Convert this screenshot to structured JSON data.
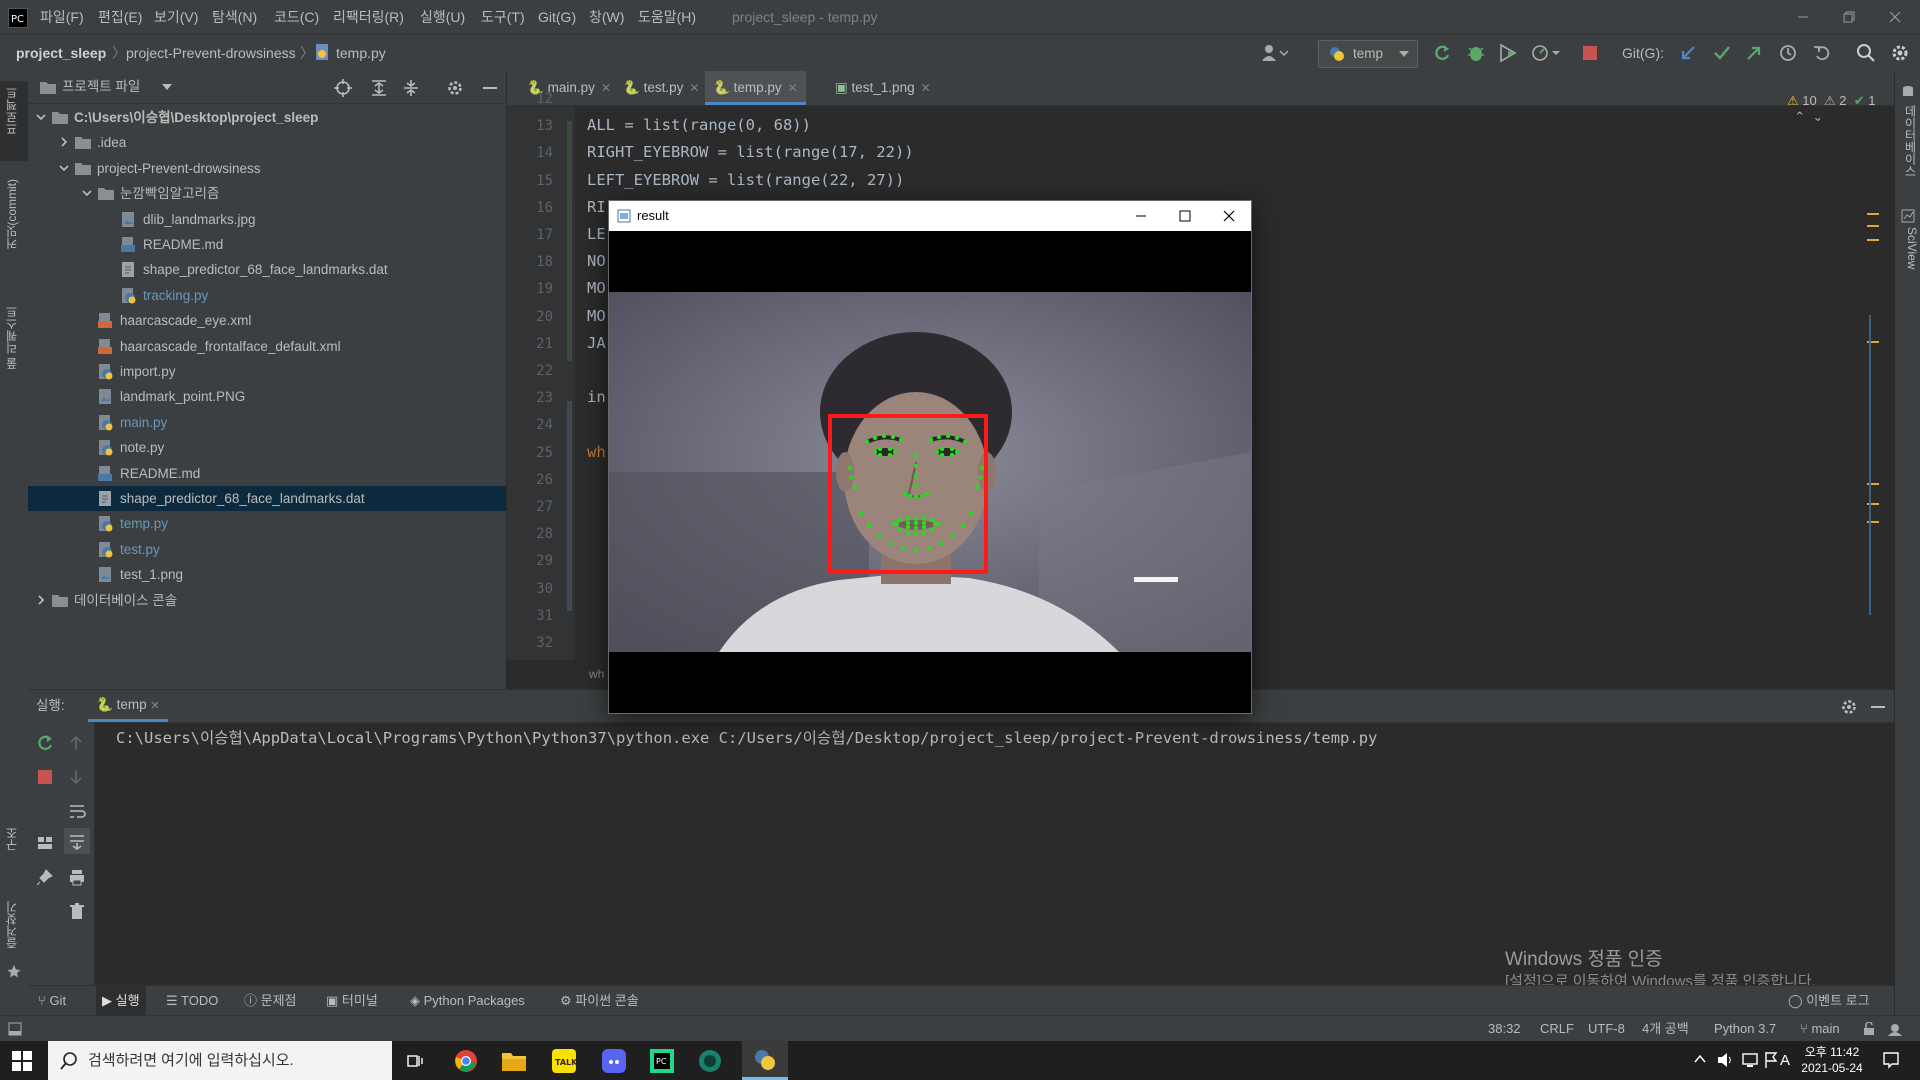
{
  "menubar": {
    "items": [
      "파일(F)",
      "편집(E)",
      "보기(V)",
      "탐색(N)",
      "코드(C)",
      "리팩터링(R)",
      "실행(U)",
      "도구(T)",
      "Git(G)",
      "창(W)",
      "도움말(H)"
    ],
    "window_title": "project_sleep - temp.py"
  },
  "toolbar": {
    "breadcrumb": [
      "project_sleep",
      "project-Prevent-drowsiness",
      "temp.py"
    ],
    "run_config": "temp",
    "git_label": "Git(G):"
  },
  "left_strip": {
    "project_label": "프로젝트",
    "commit_label": "커밋(commit)",
    "pull_label": "풀 리퀘스트",
    "structure_label": "구조",
    "favorites_label": "즐겨찾기"
  },
  "right_strip": {
    "db_label": "데이터베이스",
    "sciview_label": "SciView"
  },
  "project": {
    "header": "프로젝트 파일",
    "tree": [
      {
        "label": "C:\\Users\\이승협\\Desktop\\project_sleep",
        "depth": 0,
        "kind": "folder",
        "expanded": true,
        "bold": true
      },
      {
        "label": ".idea",
        "depth": 1,
        "kind": "folder",
        "expanded": false
      },
      {
        "label": "project-Prevent-drowsiness",
        "depth": 1,
        "kind": "folder",
        "expanded": true
      },
      {
        "label": "눈깜빡임알고리즘",
        "depth": 2,
        "kind": "folder",
        "expanded": true
      },
      {
        "label": "dlib_landmarks.jpg",
        "depth": 3,
        "kind": "image"
      },
      {
        "label": "README.md",
        "depth": 3,
        "kind": "md"
      },
      {
        "label": "shape_predictor_68_face_landmarks.dat",
        "depth": 3,
        "kind": "file"
      },
      {
        "label": "tracking.py",
        "depth": 3,
        "kind": "py",
        "modified": true
      },
      {
        "label": "haarcascade_eye.xml",
        "depth": 2,
        "kind": "xml"
      },
      {
        "label": "haarcascade_frontalface_default.xml",
        "depth": 2,
        "kind": "xml"
      },
      {
        "label": "import.py",
        "depth": 2,
        "kind": "py"
      },
      {
        "label": "landmark_point.PNG",
        "depth": 2,
        "kind": "image"
      },
      {
        "label": "main.py",
        "depth": 2,
        "kind": "py",
        "modified": true
      },
      {
        "label": "note.py",
        "depth": 2,
        "kind": "py"
      },
      {
        "label": "README.md",
        "depth": 2,
        "kind": "md"
      },
      {
        "label": "shape_predictor_68_face_landmarks.dat",
        "depth": 2,
        "kind": "file",
        "selected": true
      },
      {
        "label": "temp.py",
        "depth": 2,
        "kind": "py",
        "modified": true
      },
      {
        "label": "test.py",
        "depth": 2,
        "kind": "py",
        "modified": true
      },
      {
        "label": "test_1.png",
        "depth": 2,
        "kind": "image"
      },
      {
        "label": "데이터베이스 콘솔",
        "depth": 0,
        "kind": "folder",
        "expanded": false
      }
    ]
  },
  "editor": {
    "tabs": [
      {
        "label": "main.py",
        "active": false
      },
      {
        "label": "test.py",
        "active": false
      },
      {
        "label": "temp.py",
        "active": true
      },
      {
        "label": "test_1.png",
        "active": false
      }
    ],
    "line_numbers": [
      "12",
      "13",
      "14",
      "15",
      "16",
      "17",
      "18",
      "19",
      "20",
      "21",
      "22",
      "23",
      "24",
      "25",
      "26",
      "27",
      "28",
      "29",
      "30",
      "31",
      "32"
    ],
    "code_line_13": "ALL = list(range(0, 68))",
    "code_line_14": "RIGHT_EYEBROW = list(range(17, 22))",
    "code_line_15": "LEFT_EYEBROW = list(range(22, 27))",
    "code_line_16": "RI",
    "code_line_17": "LE",
    "code_line_18": "NO",
    "code_line_19": "MO",
    "code_line_20": "MO",
    "code_line_21": "JA",
    "code_line_23": "in",
    "code_line_25": "wh",
    "breadcrumb_bottom": "wh",
    "inspections": {
      "warnings": "10",
      "weak_warnings": "2",
      "ok": "1"
    }
  },
  "result_window": {
    "title": "result"
  },
  "run_panel": {
    "label": "실행:",
    "tab": "temp",
    "output": "C:\\Users\\이승협\\AppData\\Local\\Programs\\Python\\Python37\\python.exe C:/Users/이승협/Desktop/project_sleep/project-Prevent-drowsiness/temp.py"
  },
  "bottom_tools": [
    "Git",
    "실행",
    "TODO",
    "문제점",
    "터미널",
    "Python Packages",
    "파이썬 콘솔"
  ],
  "event_log": "이벤트 로그",
  "watermark": {
    "line1": "Windows 정품 인증",
    "line2": "[설정]으로 이동하여 Windows를 정품 인증합니다."
  },
  "statusbar": {
    "position": "38:32",
    "line_sep": "CRLF",
    "encoding": "UTF-8",
    "indent": "4개 공백",
    "interpreter": "Python 3.7",
    "branch": "main"
  },
  "taskbar": {
    "search_placeholder": "검색하려면 여기에 입력하십시오.",
    "time": "오후 11:42",
    "date": "2021-05-24",
    "ime": "A"
  },
  "colors": {
    "accent": "#4a88c7",
    "bbox": "#ff1a1a",
    "landmark": "#22dd22",
    "selection": "#0d293e"
  }
}
